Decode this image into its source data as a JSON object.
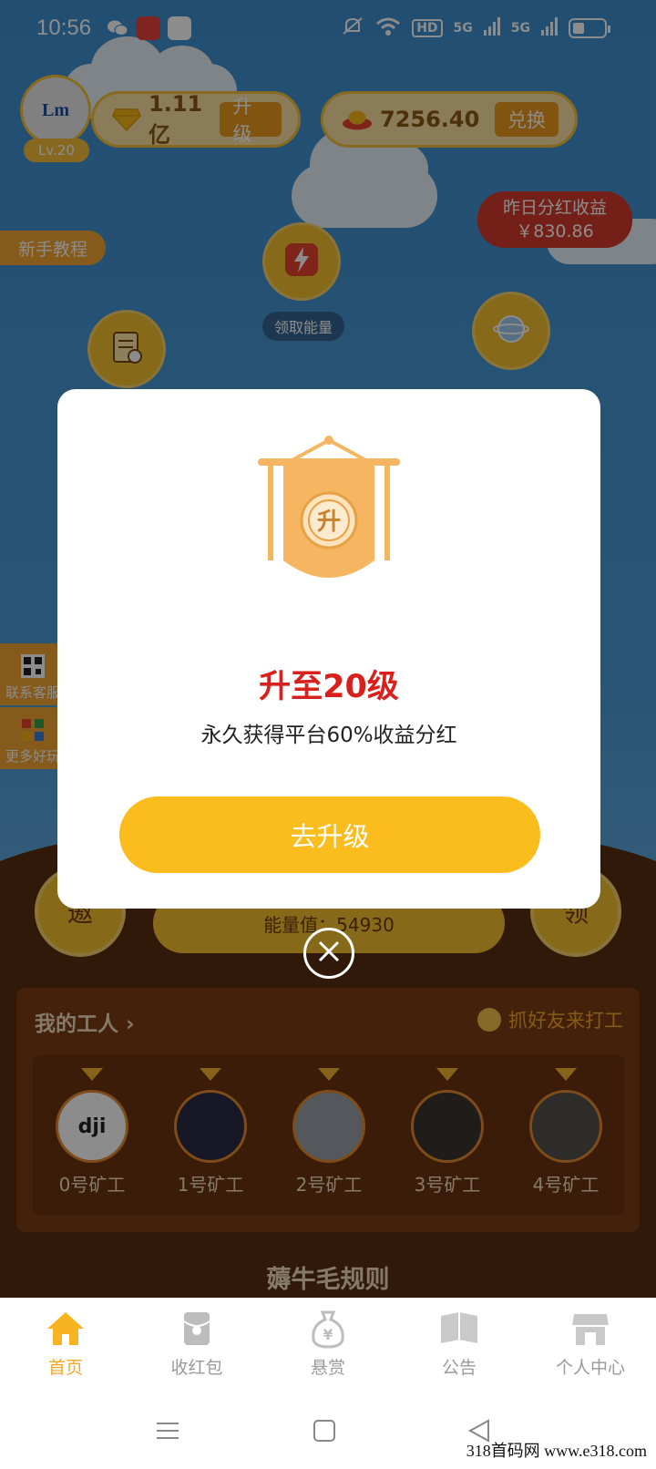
{
  "status": {
    "time": "10:56",
    "network_left": "HD",
    "network_5g_1": "5G",
    "network_5g_2": "5G"
  },
  "user": {
    "avatar_text": "Lm",
    "level": "Lv.20"
  },
  "diamond": {
    "value": "1.11亿",
    "button": "升级"
  },
  "coin": {
    "value": "7256.40",
    "button": "兑换"
  },
  "dividend": {
    "label": "昨日分红收益",
    "amount": "￥830.86"
  },
  "tutorial_label": "新手教程",
  "energy": {
    "claim_label": "领取能量",
    "value_label": "能量值：54930"
  },
  "side": {
    "contact_label": "联系客服",
    "more_label": "更多好玩"
  },
  "round_buttons": {
    "left": "邀",
    "right": "领"
  },
  "workers": {
    "title": "我的工人",
    "invite": "抓好友来打工",
    "items": [
      {
        "name": "0号矿工",
        "avatar": "dji"
      },
      {
        "name": "1号矿工",
        "avatar": ""
      },
      {
        "name": "2号矿工",
        "avatar": ""
      },
      {
        "name": "3号矿工",
        "avatar": ""
      },
      {
        "name": "4号矿工",
        "avatar": ""
      }
    ]
  },
  "rules_title": "薅牛毛规则",
  "modal": {
    "badge_char": "升",
    "title": "升至20级",
    "description": "永久获得平台60%收益分红",
    "button": "去升级"
  },
  "tabs": [
    {
      "label": "首页",
      "icon": "home-icon",
      "active": true
    },
    {
      "label": "收红包",
      "icon": "red-packet-icon",
      "active": false
    },
    {
      "label": "悬赏",
      "icon": "money-bag-icon",
      "active": false
    },
    {
      "label": "公告",
      "icon": "announcement-icon",
      "active": false
    },
    {
      "label": "个人中心",
      "icon": "store-icon",
      "active": false
    }
  ],
  "watermark": "318首码网  www.e318.com",
  "colors": {
    "accent": "#fbbd1e",
    "title_red": "#d8201c",
    "tab_active": "#f5a623"
  }
}
